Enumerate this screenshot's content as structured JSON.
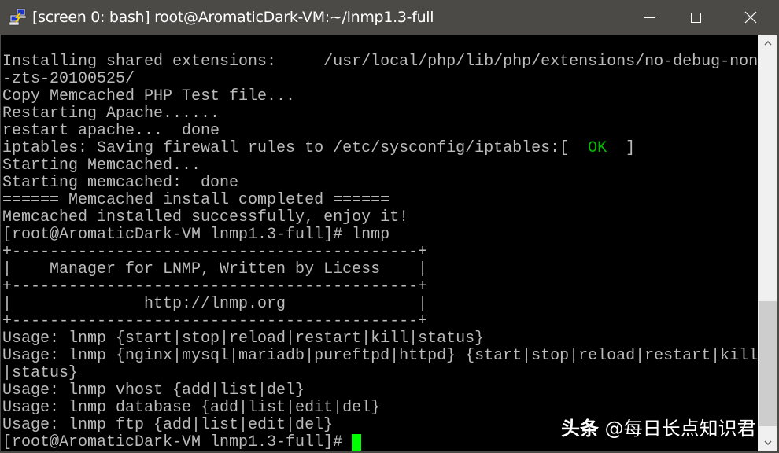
{
  "window": {
    "title": "[screen 0: bash] root@AromaticDark-VM:~/lnmp1.3-full",
    "app_icon": "putty-icon",
    "controls": {
      "minimize": "minimize-icon",
      "maximize": "maximize-icon",
      "close": "close-icon"
    }
  },
  "terminal": {
    "lines": [
      {
        "text": "Installing shared extensions:     /usr/local/php/lib/php/extensions/no-debug-non"
      },
      {
        "text": "-zts-20100525/"
      },
      {
        "text": "Copy Memcached PHP Test file..."
      },
      {
        "text": "Restarting Apache......"
      },
      {
        "text": "restart apache...  done"
      },
      {
        "text": "iptables: Saving firewall rules to /etc/sysconfig/iptables:[  ",
        "ok": "OK",
        "after": "  ]"
      },
      {
        "text": "Starting Memcached..."
      },
      {
        "text": "Starting memcached:  done"
      },
      {
        "text": "====== Memcached install completed ======"
      },
      {
        "text": "Memcached installed successfully, enjoy it!"
      },
      {
        "text": "[root@AromaticDark-VM lnmp1.3-full]# lnmp"
      },
      {
        "text": "+-------------------------------------------+"
      },
      {
        "text": "|    Manager for LNMP, Written by Licess    |"
      },
      {
        "text": "+-------------------------------------------+"
      },
      {
        "text": "|              http://lnmp.org              |"
      },
      {
        "text": "+-------------------------------------------+"
      },
      {
        "text": "Usage: lnmp {start|stop|reload|restart|kill|status}"
      },
      {
        "text": "Usage: lnmp {nginx|mysql|mariadb|pureftpd|httpd} {start|stop|reload|restart|kill"
      },
      {
        "text": "|status}"
      },
      {
        "text": "Usage: lnmp vhost {add|list|del}"
      },
      {
        "text": "Usage: lnmp database {add|list|edit|del}"
      },
      {
        "text": "Usage: lnmp ftp {add|list|edit|del}"
      },
      {
        "text": "[root@AromaticDark-VM lnmp1.3-full]# ",
        "cursor": true
      }
    ],
    "colors": {
      "background": "#000000",
      "foreground": "#bbbbbb",
      "ok": "#00bb00",
      "cursor": "#00ff00"
    }
  },
  "scrollbar": {
    "up_icon": "chevron-up-icon",
    "down_icon": "chevron-down-icon",
    "position_fraction": 0.66
  },
  "watermark": {
    "brand": "头条",
    "handle": "@每日长点知识君"
  }
}
